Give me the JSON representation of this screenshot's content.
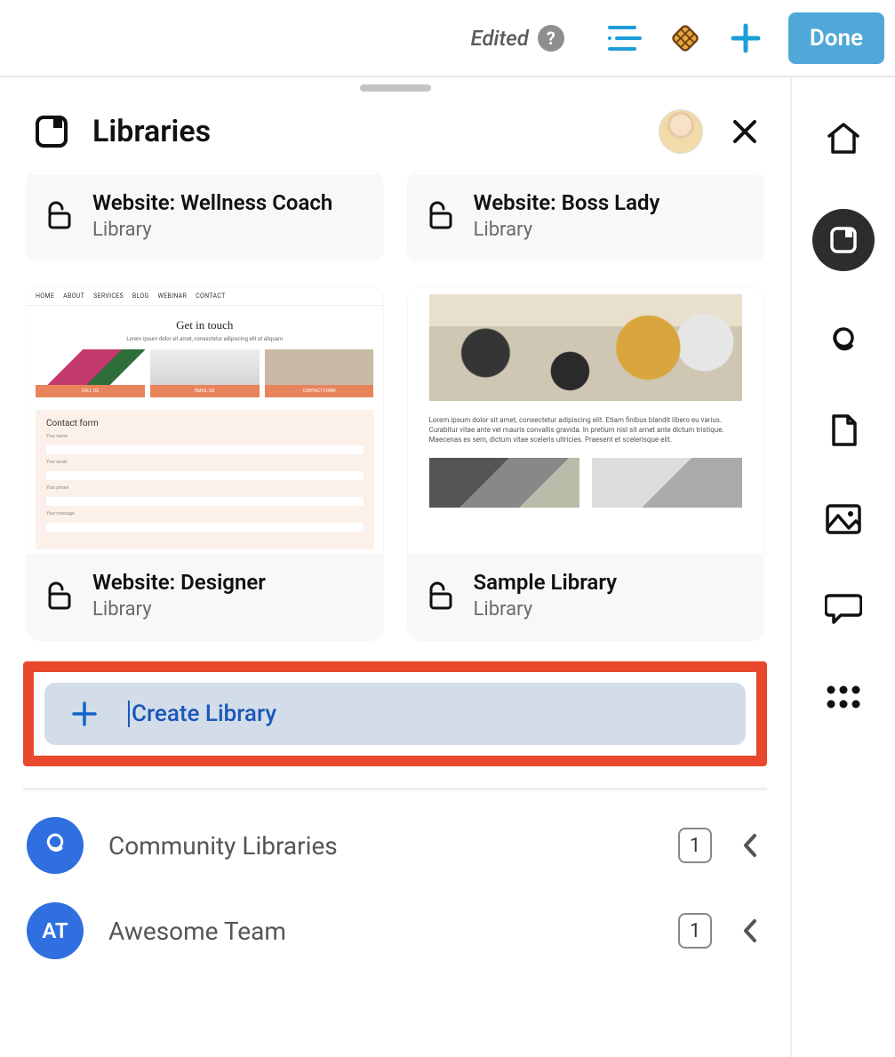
{
  "topbar": {
    "edited_label": "Edited",
    "done_label": "Done"
  },
  "panel": {
    "title": "Libraries"
  },
  "cards": [
    {
      "title": "Website: Wellness Coach",
      "subtitle": "Library"
    },
    {
      "title": "Website: Boss Lady",
      "subtitle": "Library"
    },
    {
      "title": "Website: Designer",
      "subtitle": "Library"
    },
    {
      "title": "Sample Library",
      "subtitle": "Library"
    }
  ],
  "preview_designer": {
    "nav": [
      "HOME",
      "ABOUT",
      "SERVICES",
      "BLOG",
      "WEBINAR",
      "CONTACT"
    ],
    "heading": "Get in touch",
    "lorem": "Lorem ipsum dolor sit amet, consectetur adipiscing elit ut aliquam",
    "buttons": [
      "CALL US",
      "EMAIL US",
      "CONTACT FORM"
    ],
    "form_title": "Contact form",
    "labels": [
      "Your name",
      "Your email",
      "Your phone",
      "Your message"
    ]
  },
  "preview_sample": {
    "para": "Lorem ipsum dolor sit amet, consectetur adipiscing elit. Etiam finibus blandit libero eu varius. Curabitur vitae ante vel mauris convallis gravida. In pretium nisl sit amet ante dictum tristique. Maecenas ex sem, dictum vitae sceleris ultricies. Praesent et scelerisque elit."
  },
  "create": {
    "placeholder": "Create Library"
  },
  "groups": [
    {
      "label": "Community Libraries",
      "count": "1",
      "avatar_text": ""
    },
    {
      "label": "Awesome Team",
      "count": "1",
      "avatar_text": "AT"
    }
  ]
}
